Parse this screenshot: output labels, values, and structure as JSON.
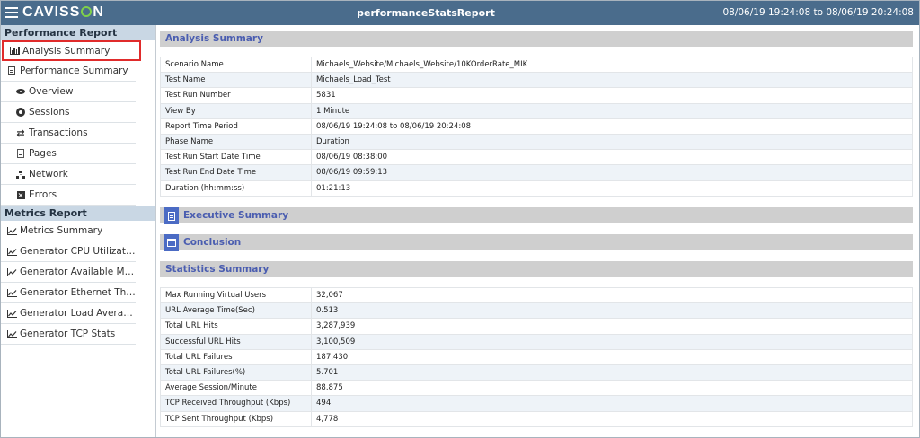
{
  "topbar": {
    "logo": "CAVISSON",
    "title": "performanceStatsReport",
    "period": "08/06/19 19:24:08 to 08/06/19 20:24:08"
  },
  "sidebar": {
    "sections": [
      {
        "title": "Performance Report",
        "items": [
          {
            "label": "Analysis Summary",
            "icon": "bar-chart-icon",
            "selected": true
          },
          {
            "label": "Performance Summary",
            "icon": "document-icon"
          },
          {
            "label": "Overview",
            "icon": "eye-icon"
          },
          {
            "label": "Sessions",
            "icon": "life-ring-icon"
          },
          {
            "label": "Transactions",
            "icon": "exchange-icon"
          },
          {
            "label": "Pages",
            "icon": "page-icon"
          },
          {
            "label": "Network",
            "icon": "sitemap-icon"
          },
          {
            "label": "Errors",
            "icon": "error-icon"
          }
        ]
      },
      {
        "title": "Metrics Report",
        "items": [
          {
            "label": "Metrics Summary",
            "icon": "line-chart-icon"
          },
          {
            "label": "Generator CPU Utilizati...",
            "icon": "line-chart-icon"
          },
          {
            "label": "Generator Available Me...",
            "icon": "line-chart-icon"
          },
          {
            "label": "Generator Ethernet Thr...",
            "icon": "line-chart-icon"
          },
          {
            "label": "Generator Load Averag...",
            "icon": "line-chart-icon"
          },
          {
            "label": "Generator TCP Stats",
            "icon": "line-chart-icon"
          }
        ]
      }
    ]
  },
  "analysis_summary": {
    "title": "Analysis Summary",
    "rows": [
      {
        "key": "Scenario Name",
        "value": "Michaels_Website/Michaels_Website/10KOrderRate_MIK"
      },
      {
        "key": "Test Name",
        "value": "Michaels_Load_Test"
      },
      {
        "key": "Test Run Number",
        "value": "5831"
      },
      {
        "key": "View By",
        "value": "1 Minute"
      },
      {
        "key": "Report Time Period",
        "value": "08/06/19 19:24:08 to 08/06/19 20:24:08"
      },
      {
        "key": "Phase Name",
        "value": "Duration"
      },
      {
        "key": "Test Run Start Date Time",
        "value": "08/06/19 08:38:00"
      },
      {
        "key": "Test Run End Date Time",
        "value": "08/06/19 09:59:13"
      },
      {
        "key": "Duration (hh:mm:ss)",
        "value": "01:21:13"
      }
    ]
  },
  "executive_summary": {
    "title": "Executive Summary",
    "icon": "file-icon"
  },
  "conclusion": {
    "title": "Conclusion",
    "icon": "calendar-check-icon"
  },
  "statistics_summary": {
    "title": "Statistics Summary",
    "rows": [
      {
        "key": "Max Running Virtual Users",
        "value": "32,067"
      },
      {
        "key": "URL Average Time(Sec)",
        "value": "0.513"
      },
      {
        "key": "Total URL Hits",
        "value": "3,287,939"
      },
      {
        "key": "Successful URL Hits",
        "value": "3,100,509"
      },
      {
        "key": "Total URL Failures",
        "value": "187,430"
      },
      {
        "key": "Total URL Failures(%)",
        "value": "5.701"
      },
      {
        "key": "Average Session/Minute",
        "value": "88.875"
      },
      {
        "key": "TCP Received Throughput (Kbps)",
        "value": "494"
      },
      {
        "key": "TCP Sent Throughput (Kbps)",
        "value": "4,778"
      }
    ]
  }
}
